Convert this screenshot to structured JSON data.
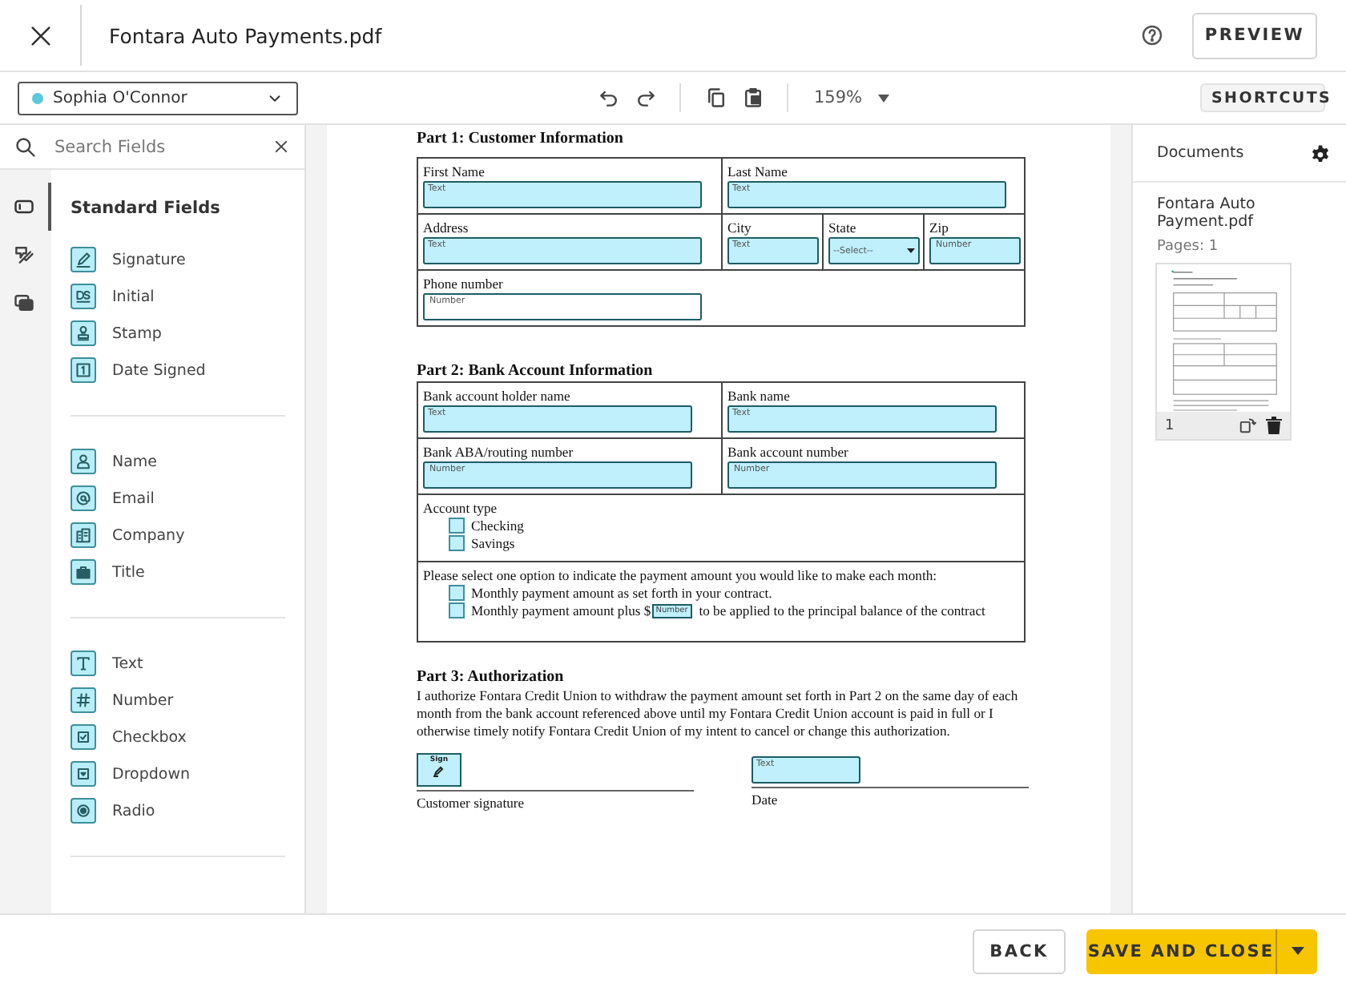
{
  "header": {
    "title": "Fontara Auto Payments.pdf",
    "preview_button": "PREVIEW"
  },
  "toolbar": {
    "signer": {
      "name": "Sophia O'Connor",
      "color": "#5cc8dc"
    },
    "zoom": "159%",
    "shortcuts_button": "SHORTCUTS"
  },
  "field_panel": {
    "search": {
      "placeholder": "Search Fields"
    },
    "tabs": [
      {
        "kind": "fields",
        "selected": true
      },
      {
        "kind": "tools",
        "selected": false
      },
      {
        "kind": "cards",
        "selected": false
      }
    ],
    "heading": "Standard Fields",
    "groups": [
      [
        {
          "label": "Signature",
          "kind": "signature"
        },
        {
          "label": "Initial",
          "kind": "initial"
        },
        {
          "label": "Stamp",
          "kind": "stamp"
        },
        {
          "label": "Date Signed",
          "kind": "date"
        }
      ],
      [
        {
          "label": "Name",
          "kind": "person"
        },
        {
          "label": "Email",
          "kind": "email"
        },
        {
          "label": "Company",
          "kind": "company"
        },
        {
          "label": "Title",
          "kind": "briefcase"
        }
      ],
      [
        {
          "label": "Text",
          "kind": "text"
        },
        {
          "label": "Number",
          "kind": "number"
        },
        {
          "label": "Checkbox",
          "kind": "checkbox"
        },
        {
          "label": "Dropdown",
          "kind": "dropdown"
        },
        {
          "label": "Radio",
          "kind": "radio"
        }
      ]
    ]
  },
  "document": {
    "part1": {
      "heading": "Part 1: Customer Information",
      "rows": [
        [
          {
            "label": "First Name",
            "field": {
              "kind": "text",
              "placeholder": "Text",
              "highlighted": true
            }
          },
          {
            "label": "Last Name",
            "field": {
              "kind": "text",
              "placeholder": "Text",
              "highlighted": true
            }
          }
        ],
        [
          {
            "label": "Address",
            "field": {
              "kind": "text",
              "placeholder": "Text",
              "highlighted": true
            }
          },
          {
            "label": "City",
            "field": {
              "kind": "text",
              "placeholder": "Text",
              "highlighted": true
            }
          },
          {
            "label": "State",
            "field": {
              "kind": "select",
              "placeholder": "--Select--",
              "highlighted": true
            }
          },
          {
            "label": "Zip",
            "field": {
              "kind": "number",
              "placeholder": "Number",
              "highlighted": true
            }
          }
        ],
        [
          {
            "label": "Phone number",
            "field": {
              "kind": "number",
              "placeholder": "Number",
              "highlighted": false
            }
          }
        ]
      ]
    },
    "part2": {
      "heading": "Part 2: Bank Account Information",
      "rows": [
        [
          {
            "label": "Bank account holder name",
            "field": {
              "kind": "text",
              "placeholder": "Text",
              "highlighted": true
            }
          },
          {
            "label": "Bank name",
            "field": {
              "kind": "text",
              "placeholder": "Text",
              "highlighted": true
            }
          }
        ],
        [
          {
            "label": "Bank ABA/routing number",
            "field": {
              "kind": "number",
              "placeholder": "Number",
              "highlighted": true
            }
          },
          {
            "label": "Bank account number",
            "field": {
              "kind": "number",
              "placeholder": "Number",
              "highlighted": true
            }
          }
        ]
      ],
      "account_type": {
        "label": "Account type",
        "options": [
          {
            "label": "Checking",
            "checked": false
          },
          {
            "label": "Savings",
            "checked": false
          }
        ]
      },
      "payment": {
        "prompt": "Please select one option to indicate the payment amount you would like to make each month:",
        "options": [
          {
            "label": "Monthly payment amount as set forth in your contract.",
            "checked": false
          },
          {
            "label": "Monthly payment amount plus $",
            "checked": false,
            "amount_placeholder": "Number",
            "suffix": "to be applied to the principal balance of the contract"
          }
        ]
      }
    },
    "part3": {
      "heading": "Part 3: Authorization",
      "body": "I authorize Fontara Credit Union to withdraw the payment amount set forth in Part 2 on the same day of each month from the bank account referenced above until my Fontara Credit Union account is paid in full or I otherwise timely notify Fontara Credit Union of my intent to cancel or change this authorization.",
      "signature": {
        "field_label": "Sign",
        "caption": "Customer signature"
      },
      "date": {
        "placeholder": "Text",
        "caption": "Date"
      }
    }
  },
  "documents_panel": {
    "title": "Documents",
    "file": "Fontara Auto Payment.pdf",
    "pages": "Pages: 1",
    "thumbnail_page": "1"
  },
  "footer": {
    "back_button": "BACK",
    "save_button": "SAVE AND CLOSE"
  }
}
